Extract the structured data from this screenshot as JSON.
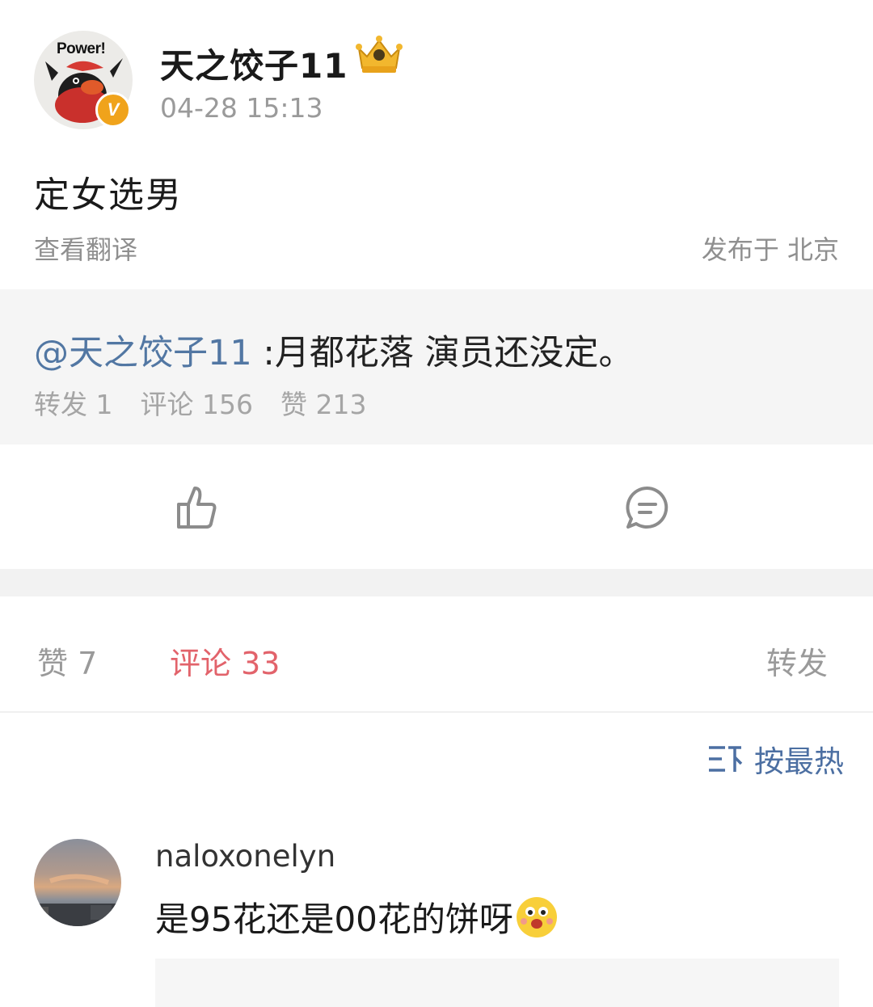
{
  "post": {
    "author": "天之饺子11",
    "time": "04-28 15:13",
    "avatar_text": "Power!",
    "verified_badge": "V",
    "text": "定女选男",
    "translate_label": "查看翻译",
    "location": "发布于 北京"
  },
  "quoted": {
    "mention": "@天之饺子11",
    "text": " :月都花落 演员还没定。",
    "stats": {
      "reposts": "转发 1",
      "comments": "评论 156",
      "likes": "赞 213"
    }
  },
  "actions": {
    "like_icon": "thumbs-up-icon",
    "comment_icon": "comment-bubble-icon"
  },
  "tabs": {
    "likes": "赞 7",
    "comments": "评论 33",
    "reposts": "转发"
  },
  "sort": {
    "label": "按最热",
    "icon": "sort-icon"
  },
  "comments": [
    {
      "user": "naloxonelyn",
      "text": "是95花还是00花的饼呀",
      "emoji": "happy-face-emoji"
    }
  ],
  "colors": {
    "mention": "#5277a3",
    "active_tab": "#e2636b",
    "sort": "#4c6fa2",
    "muted": "#9a9a9a",
    "quote_bg": "#f5f5f5"
  }
}
